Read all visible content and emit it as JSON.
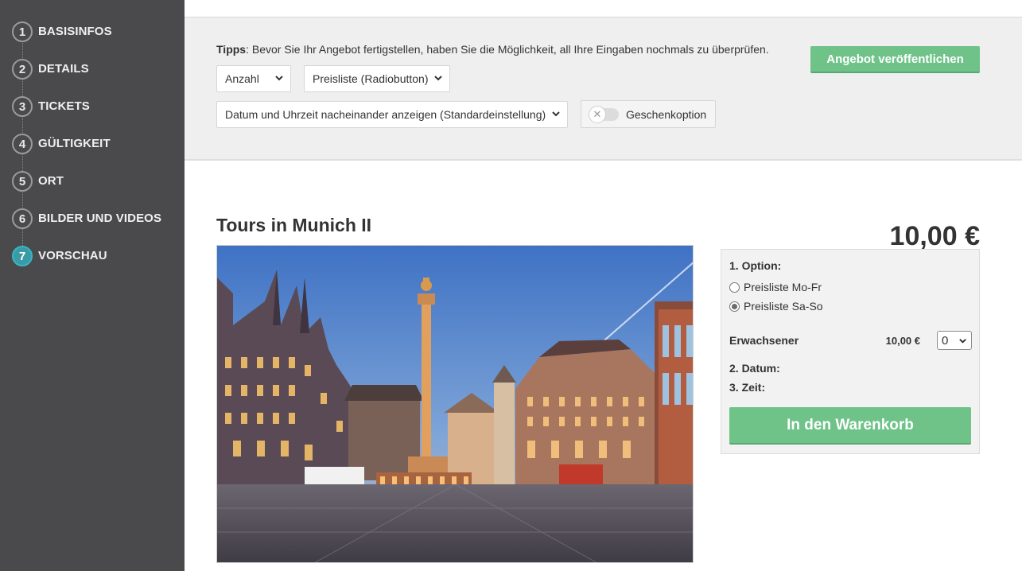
{
  "sidebar": {
    "steps": [
      {
        "num": "1",
        "label": "BASISINFOS"
      },
      {
        "num": "2",
        "label": "DETAILS"
      },
      {
        "num": "3",
        "label": "TICKETS"
      },
      {
        "num": "4",
        "label": "GÜLTIGKEIT"
      },
      {
        "num": "5",
        "label": "ORT"
      },
      {
        "num": "6",
        "label": "BILDER UND VIDEOS"
      },
      {
        "num": "7",
        "label": "VORSCHAU",
        "active": true
      }
    ]
  },
  "toolbar": {
    "tips_label": "Tipps",
    "tips_text": ": Bevor Sie Ihr Angebot fertigstellen, haben Sie die Möglichkeit, all Ihre Eingaben nochmals zu überprüfen.",
    "select_amount": "Anzahl",
    "select_pricelist": "Preisliste (Radiobutton)",
    "select_datetime": "Datum und Uhrzeit nacheinander anzeigen (Standardeinstellung)",
    "gift_option_label": "Geschenkoption",
    "gift_option_on": false,
    "publish_label": "Angebot veröffentlichen"
  },
  "offer": {
    "title": "Tours in Munich II",
    "price": "10,00 €"
  },
  "booking": {
    "option_label": "1. Option:",
    "price_lists": [
      {
        "label": "Preisliste Mo-Fr",
        "selected": false
      },
      {
        "label": "Preisliste Sa-So",
        "selected": true
      }
    ],
    "adult_label": "Erwachsener",
    "adult_price": "10,00 €",
    "adult_qty": "0",
    "date_label": "2. Datum:",
    "time_label": "3. Zeit:",
    "cart_label": "In den Warenkorb"
  },
  "colors": {
    "sidebar_bg": "#4a4a4d",
    "accent_green": "#6fc389",
    "active_step": "#35b8c4",
    "toolbar_bg": "#efefef"
  }
}
